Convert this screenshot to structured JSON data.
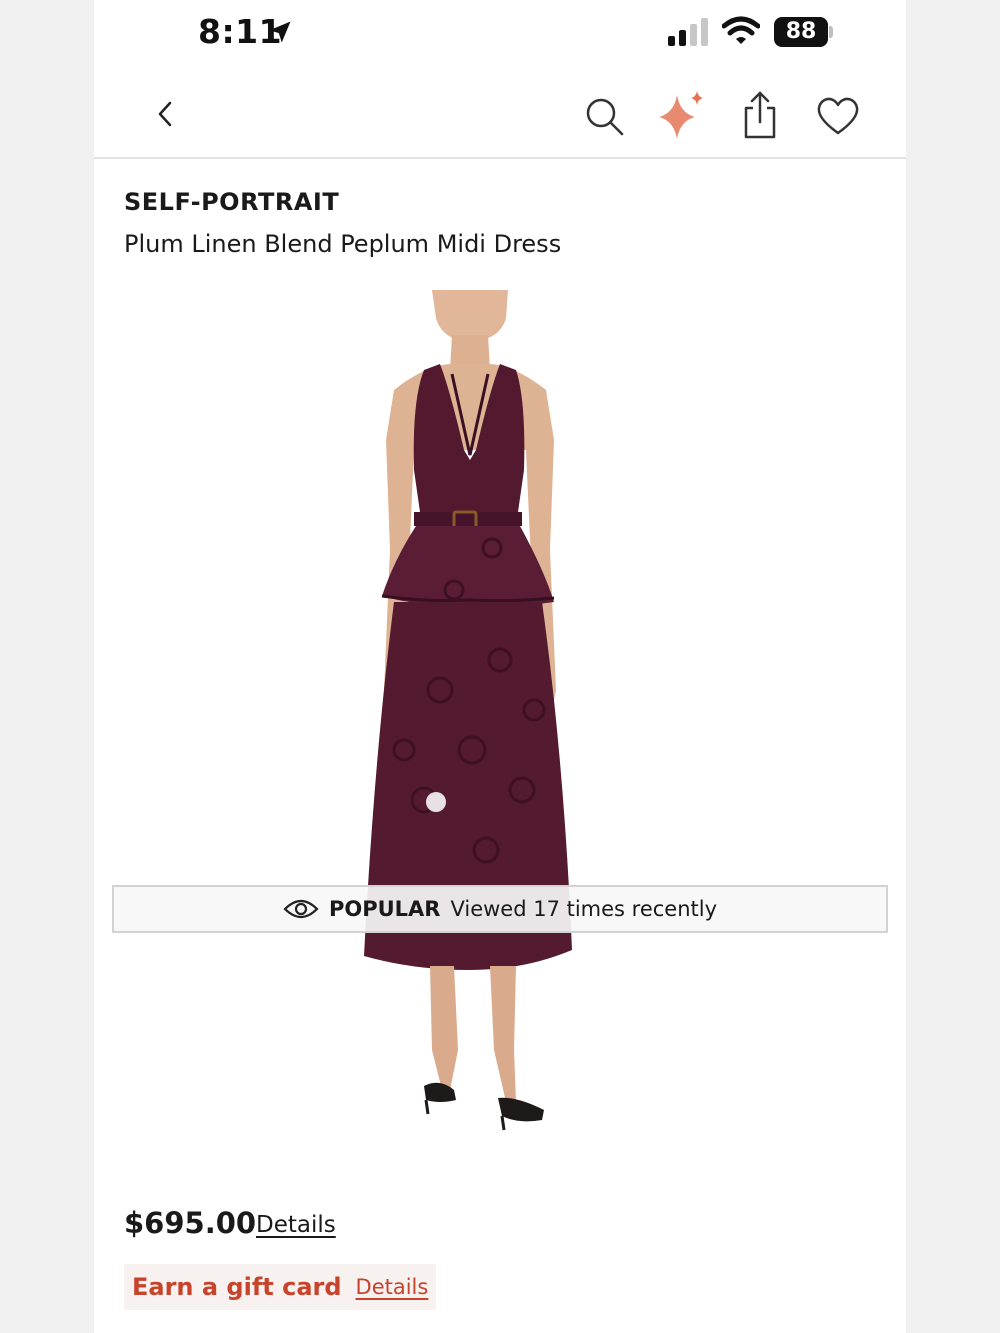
{
  "status_bar": {
    "time": "8:11",
    "battery": "88"
  },
  "nav": {
    "back": "back-icon",
    "icons": [
      "search-icon",
      "sparkle-icon",
      "share-icon",
      "heart-icon"
    ],
    "accent": "#e88a70"
  },
  "product": {
    "brand": "SELF-PORTRAIT",
    "name": "Plum Linen Blend Peplum Midi Dress",
    "color": "#4f1a2e"
  },
  "popular_banner": {
    "label": "POPULAR",
    "text": "Viewed 17 times recently"
  },
  "pricing": {
    "price": "$695.00",
    "details_link": "Details",
    "gift_card": "Earn a gift card",
    "gift_details_link": "Details",
    "gift_color": "#c7432b"
  }
}
